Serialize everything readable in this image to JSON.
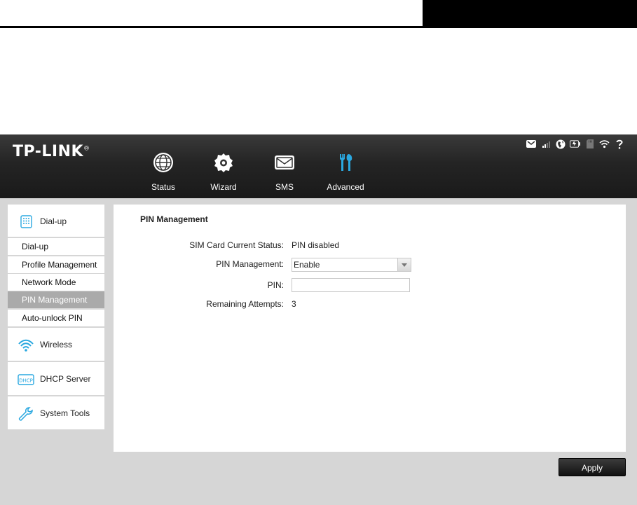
{
  "brand": {
    "logo": "TP-LINK",
    "logo_mark": "®"
  },
  "nav": [
    {
      "label": "Status",
      "icon": "globe-icon"
    },
    {
      "label": "Wizard",
      "icon": "gear-icon"
    },
    {
      "label": "SMS",
      "icon": "envelope-icon"
    },
    {
      "label": "Advanced",
      "icon": "tools-icon",
      "active": true
    }
  ],
  "status_icons": [
    "mail-icon",
    "signal-icon",
    "internet-icon",
    "battery-icon",
    "sd-card-icon",
    "wifi-icon",
    "help-icon"
  ],
  "sidebar": {
    "groups": [
      {
        "label": "Dial-up",
        "icon": "dialup-icon"
      },
      {
        "label": "Wireless",
        "icon": "wifi-icon"
      },
      {
        "label": "DHCP Server",
        "icon": "dhcp-icon"
      },
      {
        "label": "System Tools",
        "icon": "wrench-icon"
      }
    ],
    "items": [
      "Dial-up",
      "Profile Management",
      "Network Mode",
      "PIN Management",
      "Auto-unlock PIN"
    ],
    "active_item": "PIN Management"
  },
  "panel": {
    "title": "PIN Management",
    "sim_status_label": "SIM Card Current Status:",
    "sim_status_value": "PIN disabled",
    "pin_mgmt_label": "PIN Management:",
    "pin_mgmt_value": "Enable",
    "pin_label": "PIN:",
    "pin_value": "",
    "remaining_label": "Remaining Attempts:",
    "remaining_value": "3"
  },
  "apply_label": "Apply",
  "colors": {
    "accent_active": "#2aa8e0",
    "sidebar_active": "#aaaaaa"
  }
}
